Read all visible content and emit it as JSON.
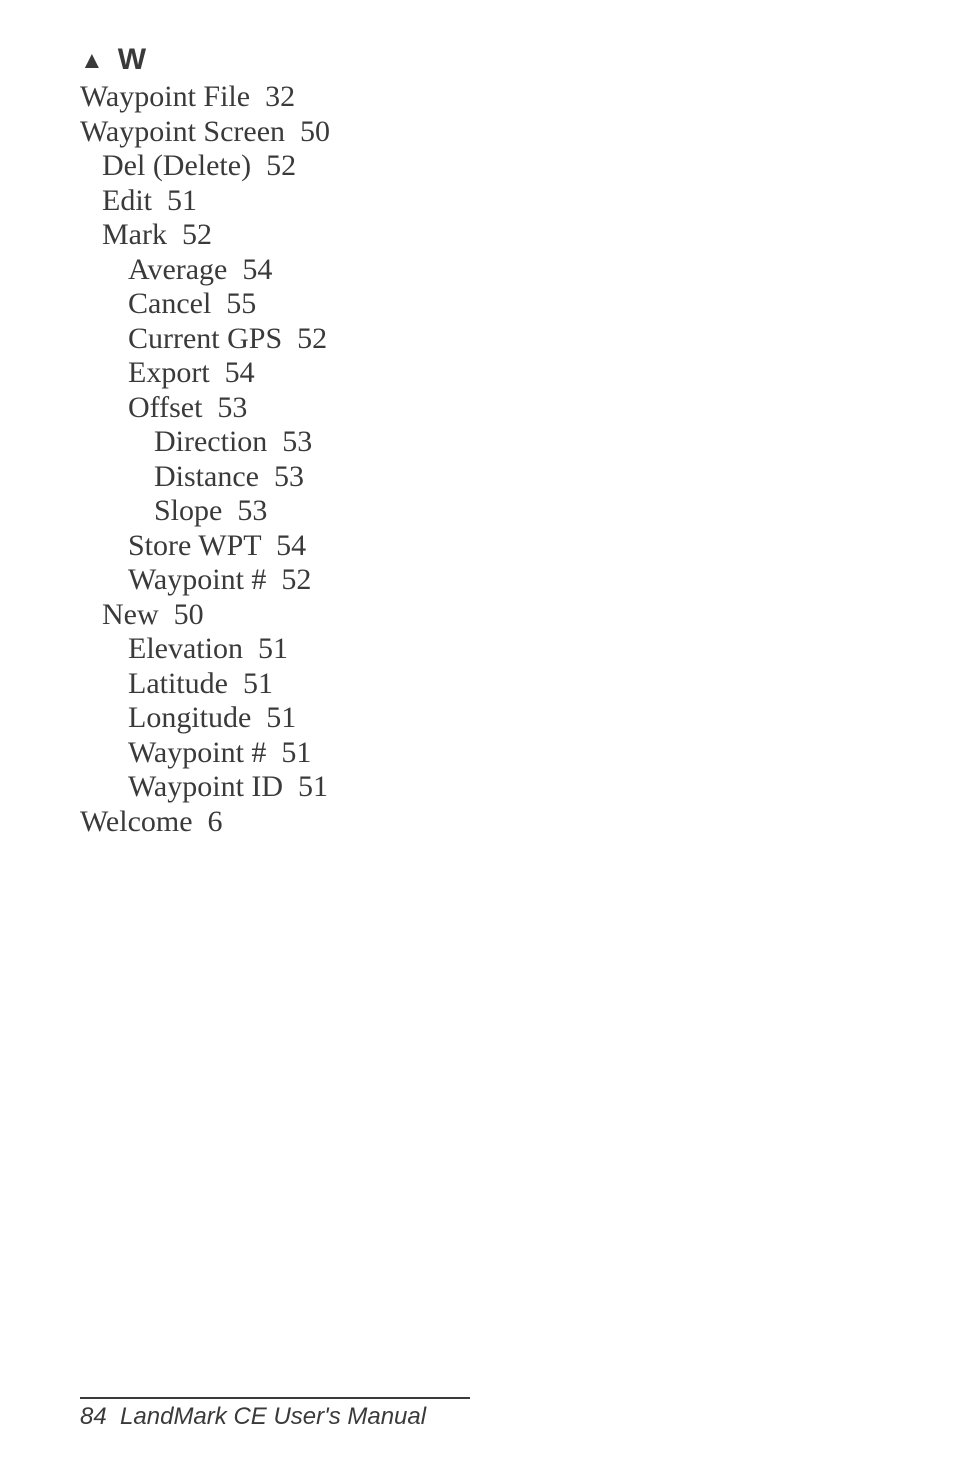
{
  "section": {
    "letter": "W",
    "marker": "▲"
  },
  "entries": [
    {
      "lv": 0,
      "text": "Waypoint File  32"
    },
    {
      "lv": 0,
      "text": "Waypoint Screen  50"
    },
    {
      "lv": 1,
      "text": "Del (Delete)  52"
    },
    {
      "lv": 1,
      "text": "Edit  51"
    },
    {
      "lv": 1,
      "text": "Mark  52"
    },
    {
      "lv": 2,
      "text": "Average  54"
    },
    {
      "lv": 2,
      "text": "Cancel  55"
    },
    {
      "lv": 2,
      "text": "Current GPS  52"
    },
    {
      "lv": 2,
      "text": "Export  54"
    },
    {
      "lv": 2,
      "text": "Offset  53"
    },
    {
      "lv": 3,
      "text": "Direction  53"
    },
    {
      "lv": 3,
      "text": "Distance  53"
    },
    {
      "lv": 3,
      "text": "Slope  53"
    },
    {
      "lv": 2,
      "text": "Store WPT  54"
    },
    {
      "lv": 2,
      "text": "Waypoint #  52"
    },
    {
      "lv": 1,
      "text": "New  50"
    },
    {
      "lv": 2,
      "text": "Elevation  51"
    },
    {
      "lv": 2,
      "text": "Latitude  51"
    },
    {
      "lv": 2,
      "text": "Longitude  51"
    },
    {
      "lv": 2,
      "text": "Waypoint #  51"
    },
    {
      "lv": 2,
      "text": "Waypoint ID  51"
    },
    {
      "lv": 0,
      "text": "Welcome  6"
    }
  ],
  "footer": {
    "page_number": "84",
    "title": "LandMark CE User's Manual"
  }
}
